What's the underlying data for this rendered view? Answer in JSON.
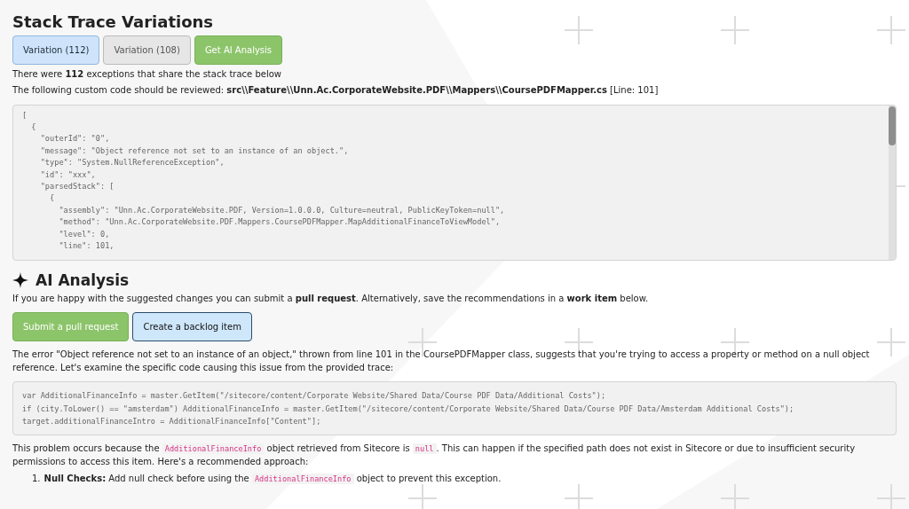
{
  "title": "Stack Trace Variations",
  "variations": [
    {
      "label": "Variation (112)",
      "selected": true
    },
    {
      "label": "Variation (108)",
      "selected": false
    }
  ],
  "analysis_button": "Get AI Analysis",
  "summary": "There were **112** exceptions that share the stack trace below",
  "review_note": "The following custom code should be reviewed: **src\\\\Feature\\\\Unn.Ac.CorporateWebsite.PDF\\\\Mappers\\\\CoursePDFMapper.cs** [Line: 101]",
  "stack_trace": [
    "[",
    "  {",
    "    \"outerId\": \"0\",",
    "    \"message\": \"Object reference not set to an instance of an object.\",",
    "    \"type\": \"System.NullReferenceException\",",
    "    \"id\": \"xxx\",",
    "    \"parsedStack\": [",
    "      {",
    "        \"assembly\": \"Unn.Ac.CorporateWebsite.PDF, Version=1.0.0.0, Culture=neutral, PublicKeyToken=null\",",
    "        \"method\": \"Unn.Ac.CorporateWebsite.PDF.Mappers.CoursePDFMapper.MapAdditionalFinanceToViewModel\",",
    "        \"level\": 0,",
    "        \"line\": 101,"
  ],
  "ai": {
    "heading": "AI Analysis",
    "intro": "If you are happy with the suggested changes you can submit a **pull request**. Alternatively, save the recommendations in a **work item** below.",
    "buttons": [
      {
        "label": "Submit a pull request",
        "kind": "primary"
      },
      {
        "label": "Create a backlog item",
        "kind": "secondary"
      }
    ],
    "explanation": "The error \"Object reference not set to an instance of an object,\" thrown from line 101 in the CoursePDFMapper class, suggests that you're trying to access a property or method on a null object reference. Let's examine the specific code causing this issue from the provided trace:",
    "code": [
      "var AdditionalFinanceInfo = master.GetItem(\"/sitecore/content/Corporate Website/Shared Data/Course PDF Data/Additional Costs\");",
      "if (city.ToLower() == \"amsterdam\") AdditionalFinanceInfo = master.GetItem(\"/sitecore/content/Corporate Website/Shared Data/Course PDF Data/Amsterdam Additional Costs\");",
      "target.additionalFinanceIntro = AdditionalFinanceInfo[\"Content\"];"
    ],
    "problem": [
      {
        "kind": "text",
        "text": "This problem occurs because the "
      },
      {
        "kind": "code",
        "text": "AdditionalFinanceInfo"
      },
      {
        "kind": "text",
        "text": " object retrieved from Sitecore is "
      },
      {
        "kind": "code",
        "text": "null"
      },
      {
        "kind": "text",
        "text": ". This can happen if the specified path does not exist in Sitecore or due to insufficient security permissions to access this item. Here's a recommended approach:"
      }
    ],
    "steps": [
      {
        "number": "1.",
        "parts": [
          {
            "kind": "text",
            "text": "**Null Checks:** Add null check before using the "
          },
          {
            "kind": "code",
            "text": "AdditionalFinanceInfo"
          },
          {
            "kind": "text",
            "text": " object to prevent this exception."
          }
        ]
      }
    ]
  }
}
